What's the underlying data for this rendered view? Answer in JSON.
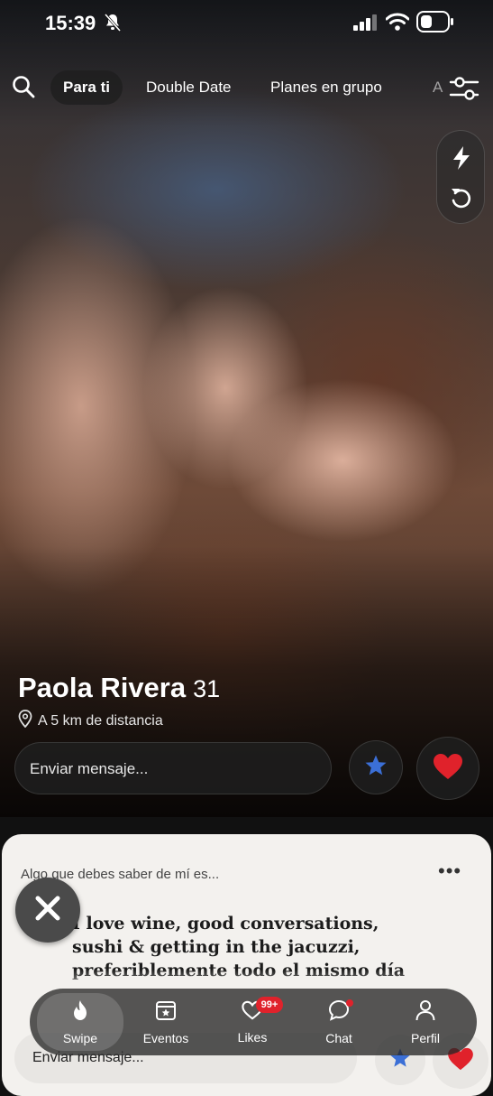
{
  "status_bar": {
    "time": "15:39"
  },
  "top_nav": {
    "tabs": [
      {
        "label": "Para ti",
        "active": true
      },
      {
        "label": "Double Date",
        "active": false
      },
      {
        "label": "Planes en grupo",
        "active": false
      },
      {
        "label": "A",
        "active": false
      }
    ]
  },
  "profile": {
    "name": "Paola Rivera",
    "age": "31",
    "distance": "A 5 km de distancia"
  },
  "card_actions": {
    "message_placeholder": "Enviar mensaje..."
  },
  "bio": {
    "prompt": "Algo que debes saber de mí es...",
    "lines": [
      "I love wine, good conversations,",
      "sushi & getting in the jacuzzi,",
      "preferiblemente todo el mismo día"
    ],
    "message_placeholder": "Enviar mensaje..."
  },
  "tab_bar": {
    "items": [
      {
        "label": "Swipe",
        "active": true
      },
      {
        "label": "Eventos",
        "active": false
      },
      {
        "label": "Likes",
        "badge": "99+",
        "active": false
      },
      {
        "label": "Chat",
        "active": false
      },
      {
        "label": "Perfil",
        "active": false
      }
    ]
  },
  "colors": {
    "like": "#e0222b",
    "star": "#3b6fd6",
    "badge": "#e0222b"
  },
  "icons": [
    "bell-slash-icon",
    "signal-icon",
    "wifi-icon",
    "battery-icon",
    "search-icon",
    "filter-icon",
    "bolt-icon",
    "rewind-icon",
    "location-pin-icon",
    "star-icon",
    "heart-icon",
    "close-icon",
    "more-icon",
    "flame-icon",
    "calendar-star-icon",
    "heart-outline-icon",
    "chat-bubble-icon",
    "person-icon"
  ]
}
